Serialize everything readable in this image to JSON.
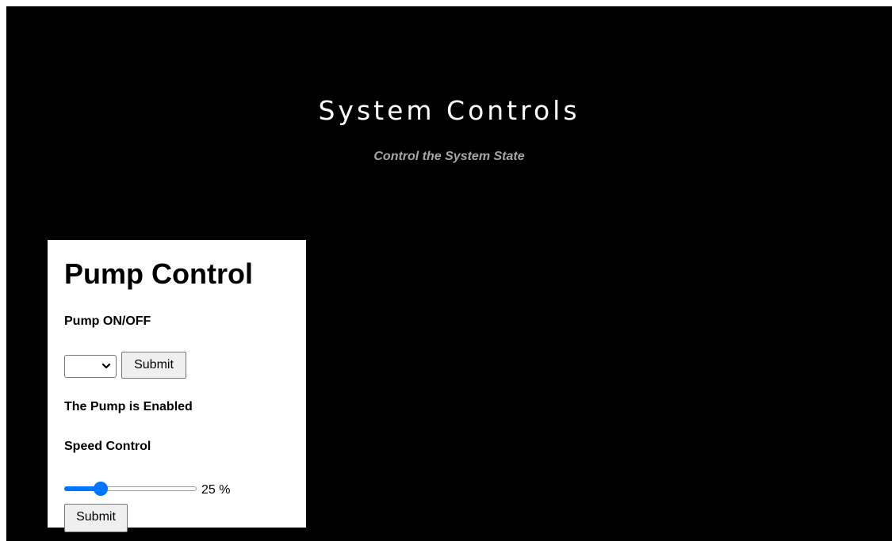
{
  "header": {
    "title": "System Controls",
    "subtitle": "Control the System State"
  },
  "pump_panel": {
    "title": "Pump Control",
    "onoff_label": "Pump ON/OFF",
    "onoff_select_value": "",
    "onoff_submit_label": "Submit",
    "status_text": "The Pump is Enabled",
    "speed_label": "Speed Control",
    "speed_value": 25,
    "speed_readout": "25 %",
    "speed_submit_label": "Submit"
  },
  "colors": {
    "background": "#000000",
    "panel": "#ffffff",
    "accent": "#0075ff",
    "subtitle": "#a6a6a6"
  },
  "icons": {
    "select_chevron": "chevron-down-icon"
  }
}
